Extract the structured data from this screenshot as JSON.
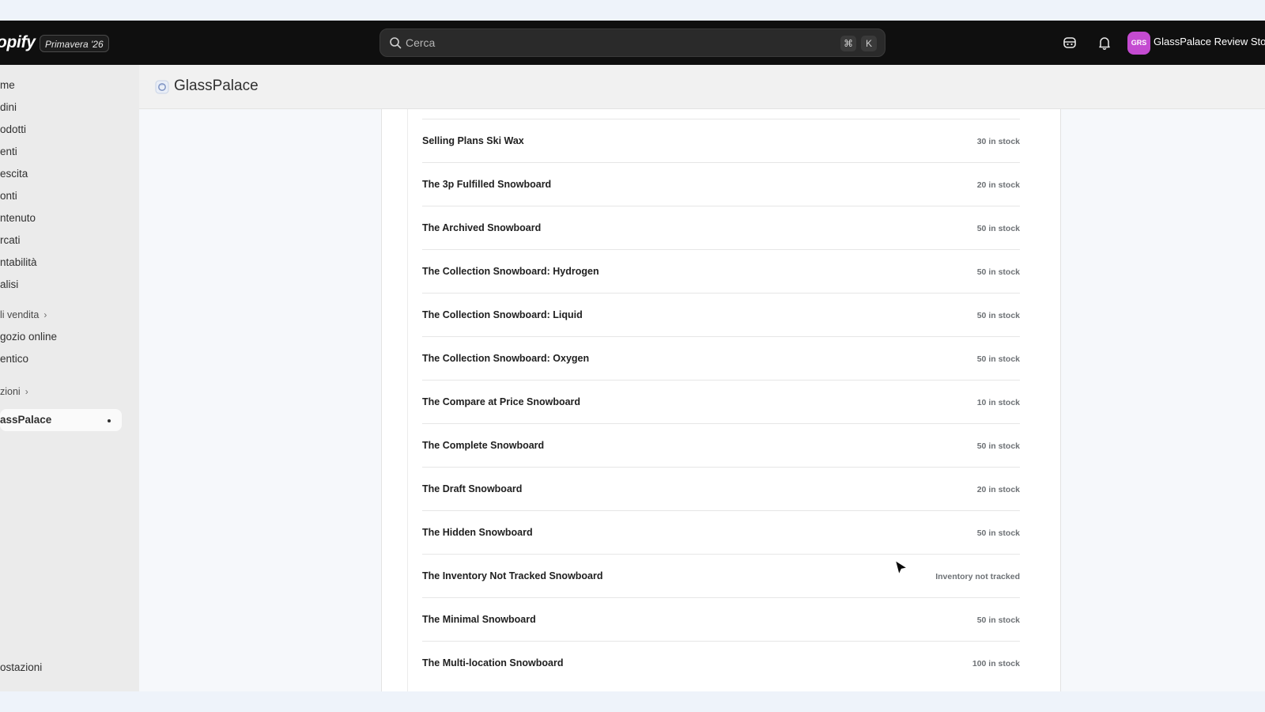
{
  "topbar": {
    "logo": "opify",
    "season_badge": "Primavera '26",
    "search_placeholder": "Cerca",
    "shortcut_cmd": "⌘",
    "shortcut_key": "K",
    "avatar_initials": "GRS",
    "store_name": "GlassPalace Review Store"
  },
  "sidebar": {
    "items": [
      {
        "label": "me"
      },
      {
        "label": "dini"
      },
      {
        "label": "odotti"
      },
      {
        "label": "enti"
      },
      {
        "label": "escita"
      },
      {
        "label": "onti"
      },
      {
        "label": "ntenuto"
      },
      {
        "label": "rcati"
      },
      {
        "label": "ntabilità"
      },
      {
        "label": "alisi"
      }
    ],
    "sales_channels_label": "li vendita",
    "channels": [
      {
        "label": "gozio online"
      },
      {
        "label": "entico"
      }
    ],
    "apps_label": "zioni",
    "active_app": "assPalace",
    "settings_label": "ostazioni"
  },
  "app_header": {
    "title": "GlassPalace"
  },
  "products": [
    {
      "name": "Selling Plans Ski Wax",
      "stock": "30 in stock"
    },
    {
      "name": "The 3p Fulfilled Snowboard",
      "stock": "20 in stock"
    },
    {
      "name": "The Archived Snowboard",
      "stock": "50 in stock"
    },
    {
      "name": "The Collection Snowboard: Hydrogen",
      "stock": "50 in stock"
    },
    {
      "name": "The Collection Snowboard: Liquid",
      "stock": "50 in stock"
    },
    {
      "name": "The Collection Snowboard: Oxygen",
      "stock": "50 in stock"
    },
    {
      "name": "The Compare at Price Snowboard",
      "stock": "10 in stock"
    },
    {
      "name": "The Complete Snowboard",
      "stock": "50 in stock"
    },
    {
      "name": "The Draft Snowboard",
      "stock": "20 in stock"
    },
    {
      "name": "The Hidden Snowboard",
      "stock": "50 in stock"
    },
    {
      "name": "The Inventory Not Tracked Snowboard",
      "stock": "Inventory not tracked"
    },
    {
      "name": "The Minimal Snowboard",
      "stock": "50 in stock"
    },
    {
      "name": "The Multi-location Snowboard",
      "stock": "100 in stock"
    }
  ],
  "colors": {
    "topbar_bg": "#0f0f0f",
    "avatar_bg": "#c44bd1",
    "sidebar_bg": "#ebebeb",
    "content_bg": "#f6f8fb"
  }
}
